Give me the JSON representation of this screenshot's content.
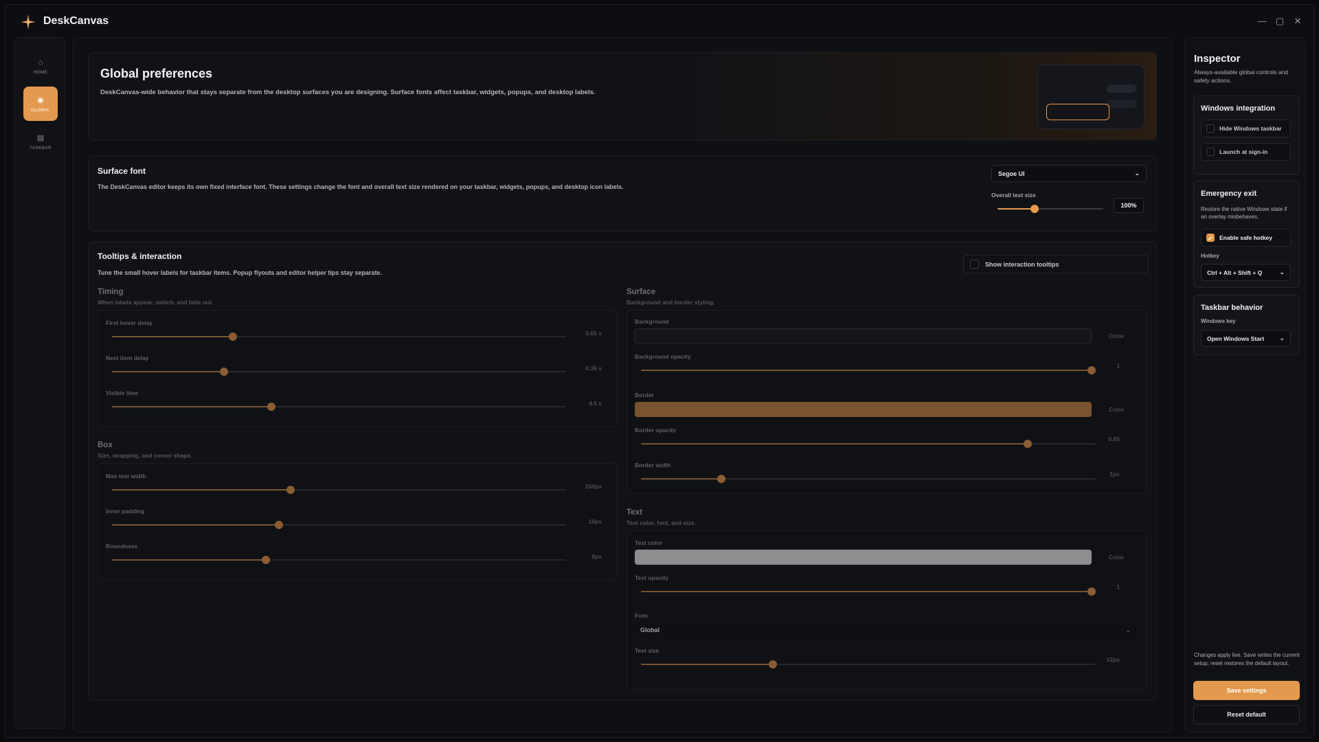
{
  "app": {
    "title": "DeskCanvas",
    "minimize": "—",
    "maximize": "▢",
    "close": "✕"
  },
  "nav": [
    {
      "icon": "home-icon",
      "glyph": "⌂",
      "label": "HOME",
      "active": false
    },
    {
      "icon": "global-icon",
      "glyph": "◉",
      "label": "GLOBAL",
      "active": true
    },
    {
      "icon": "taskbar-icon",
      "glyph": "▤",
      "label": "TASKBAR",
      "active": false
    }
  ],
  "hero": {
    "title": "Global preferences",
    "description": "DeskCanvas-wide behavior that stays separate from the desktop surfaces you are designing. Surface fonts affect taskbar, widgets, popups, and desktop labels."
  },
  "surface_font": {
    "title": "Surface font",
    "description": "The DeskCanvas editor keeps its own fixed interface font. These settings change the font and overall text size rendered on your taskbar, widgets, popups, and desktop icon labels.",
    "font_value": "Segoe UI",
    "size_label": "Overall text size",
    "size_value": "100%",
    "size_fraction": 0.35
  },
  "tooltips": {
    "title": "Tooltips & interaction",
    "description": "Tune the small hover labels for taskbar items. Popup flyouts and editor helper tips stay separate.",
    "toggle_label": "Show interaction tooltips",
    "timing": {
      "title": "Timing",
      "subtitle": "When labels appear, switch, and fade out.",
      "controls": [
        {
          "label": "First hover delay",
          "value": "0.65 s",
          "fraction": 0.267
        },
        {
          "label": "Next item delay",
          "value": "0.36 s",
          "fraction": 0.247
        },
        {
          "label": "Visible time",
          "value": "4.5 s",
          "fraction": 0.351
        }
      ]
    },
    "box": {
      "title": "Box",
      "subtitle": "Size, wrapping, and corner shape.",
      "controls": [
        {
          "label": "Max text width",
          "value": "260px",
          "fraction": 0.393
        },
        {
          "label": "Inner padding",
          "value": "10px",
          "fraction": 0.368
        },
        {
          "label": "Roundness",
          "value": "8px",
          "fraction": 0.339
        }
      ]
    },
    "surface": {
      "title": "Surface",
      "subtitle": "Background and border styling.",
      "background_label": "Background",
      "background_color": "#141519",
      "background_opacity_label": "Background opacity",
      "background_opacity_value": "1",
      "background_opacity_fraction": 1.0,
      "border_label": "Border",
      "border_color": "#7a5430",
      "border_opacity_label": "Border opacity",
      "border_opacity_value": "0.85",
      "border_opacity_fraction": 0.85,
      "border_width_label": "Border width",
      "border_width_value": "1px",
      "border_width_fraction": 0.177,
      "color_button": "Color"
    },
    "text": {
      "title": "Text",
      "subtitle": "Text color, font, and size.",
      "color_label": "Text color",
      "color_value": "#8e8e90",
      "opacity_label": "Text opacity",
      "opacity_value": "1",
      "opacity_fraction": 1.0,
      "font_label": "Font",
      "font_value": "Global",
      "size_label": "Text size",
      "size_value": "12px",
      "size_fraction": 0.29,
      "color_button": "Color"
    }
  },
  "inspector": {
    "title": "Inspector",
    "description": "Always-available global controls and safety actions.",
    "windows": {
      "title": "Windows integration",
      "hide_taskbar": "Hide Windows taskbar",
      "launch_signin": "Launch at sign-in"
    },
    "emergency": {
      "title": "Emergency exit",
      "description": "Restore the native Windows state if an overlay misbehaves.",
      "safe_hotkey": "Enable safe hotkey",
      "hotkey_label": "Hotkey",
      "hotkey_value": "Ctrl + Alt + Shift + Q"
    },
    "taskbar": {
      "title": "Taskbar behavior",
      "key_label": "Windows key",
      "key_value": "Open Windows Start"
    },
    "note": "Changes apply live. Save writes the current setup; reset restores the default layout.",
    "save": "Save settings",
    "reset": "Reset default"
  },
  "colors": {
    "accent": "#e49a4e",
    "bg": "#0d0e11",
    "panel": "#111216"
  }
}
